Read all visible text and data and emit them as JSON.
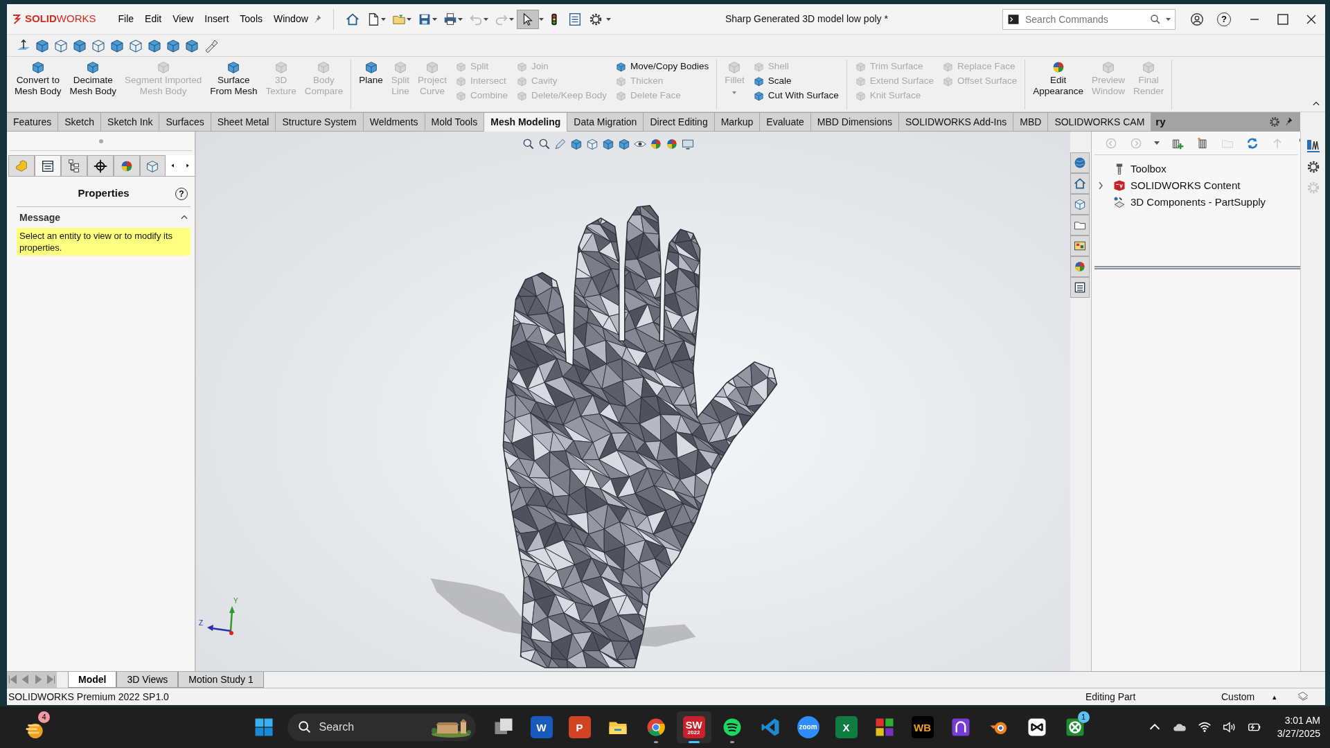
{
  "logo": "**SOLID**WORKS",
  "menu": [
    "File",
    "Edit",
    "View",
    "Insert",
    "Tools",
    "Window"
  ],
  "select_tool": {
    "selected": true
  },
  "title": "Sharp Generated 3D model low poly *",
  "search": {
    "placeholder": "Search Commands"
  },
  "help_glyph": "?",
  "ribbon": {
    "groups": [
      {
        "items": [
          {
            "kind": "large",
            "lines": [
              "Convert to",
              "Mesh Body"
            ],
            "disabled": false
          },
          {
            "kind": "large",
            "lines": [
              "Decimate",
              "Mesh Body"
            ],
            "disabled": false
          },
          {
            "kind": "large",
            "lines": [
              "Segment Imported",
              "Mesh Body"
            ],
            "disabled": true
          },
          {
            "kind": "large",
            "lines": [
              "Surface",
              "From Mesh"
            ],
            "disabled": false
          },
          {
            "kind": "large",
            "lines": [
              "3D",
              "Texture"
            ],
            "disabled": true
          },
          {
            "kind": "large",
            "lines": [
              "Body",
              "Compare"
            ],
            "disabled": true
          }
        ]
      },
      {
        "items": [
          {
            "kind": "large",
            "lines": [
              "Plane"
            ],
            "disabled": false
          },
          {
            "kind": "large",
            "lines": [
              "Split",
              "Line"
            ],
            "disabled": true
          },
          {
            "kind": "large",
            "lines": [
              "Project",
              "Curve"
            ],
            "disabled": true
          },
          {
            "kind": "stack",
            "items": [
              {
                "label": "Split",
                "disabled": true
              },
              {
                "label": "Intersect",
                "disabled": true
              },
              {
                "label": "Combine",
                "disabled": true
              }
            ]
          },
          {
            "kind": "stack",
            "items": [
              {
                "label": "Join",
                "disabled": true
              },
              {
                "label": "Cavity",
                "disabled": true
              },
              {
                "label": "Delete/Keep Body",
                "disabled": true
              }
            ]
          },
          {
            "kind": "stack",
            "items": [
              {
                "label": "Move/Copy Bodies",
                "disabled": false
              },
              {
                "label": "Thicken",
                "disabled": true
              },
              {
                "label": "Delete Face",
                "disabled": true
              }
            ]
          }
        ]
      },
      {
        "items": [
          {
            "kind": "large",
            "lines": [
              "Fillet"
            ],
            "disabled": true,
            "dropdown": true
          },
          {
            "kind": "stack",
            "items": [
              {
                "label": "Shell",
                "disabled": true
              },
              {
                "label": "Scale",
                "disabled": false
              },
              {
                "label": "Cut With Surface",
                "disabled": false
              }
            ]
          }
        ]
      },
      {
        "items": [
          {
            "kind": "stack",
            "items": [
              {
                "label": "Trim Surface",
                "disabled": true
              },
              {
                "label": "Extend Surface",
                "disabled": true
              },
              {
                "label": "Knit Surface",
                "disabled": true
              }
            ]
          },
          {
            "kind": "stack",
            "items": [
              {
                "label": "Replace Face",
                "disabled": true
              },
              {
                "label": "Offset Surface",
                "disabled": true
              }
            ]
          }
        ]
      },
      {
        "items": [
          {
            "kind": "large",
            "lines": [
              "Edit",
              "Appearance"
            ],
            "disabled": false
          },
          {
            "kind": "large",
            "lines": [
              "Preview",
              "Window"
            ],
            "disabled": true
          },
          {
            "kind": "large",
            "lines": [
              "Final",
              "Render"
            ],
            "disabled": true
          }
        ]
      }
    ]
  },
  "tabs": [
    {
      "label": "Features",
      "selected": false
    },
    {
      "label": "Sketch",
      "selected": false
    },
    {
      "label": "Sketch Ink",
      "selected": false
    },
    {
      "label": "Surfaces",
      "selected": false
    },
    {
      "label": "Sheet Metal",
      "selected": false
    },
    {
      "label": "Structure System",
      "selected": false
    },
    {
      "label": "Weldments",
      "selected": false
    },
    {
      "label": "Mold Tools",
      "selected": false
    },
    {
      "label": "Mesh Modeling",
      "selected": true
    },
    {
      "label": "Data Migration",
      "selected": false
    },
    {
      "label": "Direct Editing",
      "selected": false
    },
    {
      "label": "Markup",
      "selected": false
    },
    {
      "label": "Evaluate",
      "selected": false
    },
    {
      "label": "MBD Dimensions",
      "selected": false
    },
    {
      "label": "SOLIDWORKS Add-Ins",
      "selected": false
    },
    {
      "label": "MBD",
      "selected": false
    },
    {
      "label": "SOLIDWORKS CAM",
      "selected": false
    }
  ],
  "property_manager": {
    "tabs": [
      {
        "selected": false
      },
      {
        "selected": true
      },
      {
        "selected": false
      },
      {
        "selected": false
      },
      {
        "selected": false
      },
      {
        "selected": false
      }
    ],
    "title": "Properties",
    "section": "Message",
    "section_expanded": true,
    "message": "Select an entity to view or to modify its properties."
  },
  "viewport": {
    "triad": {
      "y": "Y",
      "z": "Z"
    }
  },
  "task_pane": {
    "title": "ry",
    "tree": [
      {
        "label": "Toolbox",
        "kind": "item"
      },
      {
        "label": "SOLIDWORKS Content",
        "kind": "folder"
      },
      {
        "label": "3D Components - PartSupply",
        "kind": "item"
      }
    ]
  },
  "bottom_tabs": [
    {
      "label": "Model",
      "selected": true
    },
    {
      "label": "3D Views",
      "selected": false
    },
    {
      "label": "Motion Study 1",
      "selected": false
    }
  ],
  "status": {
    "left": "SOLIDWORKS Premium 2022 SP1.0",
    "mode": "Editing Part",
    "units": "Custom",
    "units_caret": "▴"
  },
  "taskbar": {
    "widget_badge": "4",
    "search": "Search",
    "time": "3:01 AM",
    "date": "3/27/2025",
    "apps": [
      {
        "kind": "taskview",
        "running": false,
        "active": false
      },
      {
        "kind": "word",
        "glyph": "W",
        "running": false,
        "active": false
      },
      {
        "kind": "powerpoint",
        "glyph": "P",
        "running": false,
        "active": false
      },
      {
        "kind": "explorer",
        "running": false,
        "active": false
      },
      {
        "kind": "chrome",
        "running": true,
        "active": false
      },
      {
        "kind": "solidworks",
        "glyph": "SW",
        "sub": "2022",
        "running": true,
        "active": true
      },
      {
        "kind": "spotify",
        "running": true,
        "active": false
      },
      {
        "kind": "vscode",
        "running": false,
        "active": false
      },
      {
        "kind": "zoom",
        "glyph": "zoom",
        "running": false,
        "active": false
      },
      {
        "kind": "excel",
        "glyph": "X",
        "running": false,
        "active": false
      },
      {
        "kind": "tiles",
        "running": false,
        "active": false
      },
      {
        "kind": "wb",
        "glyph": "WB",
        "running": false,
        "active": false
      },
      {
        "kind": "ring",
        "running": false,
        "active": false
      },
      {
        "kind": "blender",
        "running": false,
        "active": false
      },
      {
        "kind": "capcut",
        "running": false,
        "active": false
      },
      {
        "kind": "xbox",
        "badge": "1",
        "running": false,
        "active": false
      }
    ]
  }
}
